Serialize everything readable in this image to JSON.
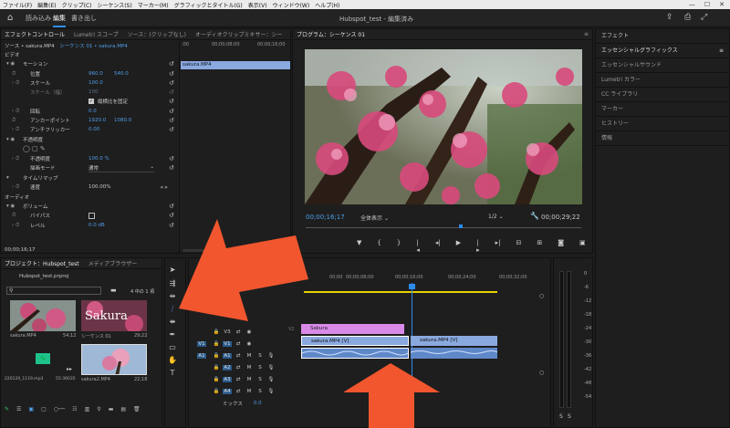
{
  "menu": [
    "ファイル(F)",
    "編集(E)",
    "クリップ(C)",
    "シーケンス(S)",
    "マーカー(M)",
    "グラフィックとタイトル(G)",
    "表示(V)",
    "ウィンドウ(W)",
    "ヘルプ(H)"
  ],
  "workspace_tabs": [
    "読み込み",
    "編集",
    "書き出し"
  ],
  "app_title": "Hubspot_test - 編集済み",
  "left_tabs": [
    "エフェクトコントロール",
    "Lumetri スコープ",
    "ソース：(クリップなし)",
    "オーディオクリップミキサー：シー"
  ],
  "source_bar": {
    "source": "ソース • sakura.MP4",
    "sequence": "シーケンス 01 • sakura.MP4"
  },
  "mini_timeline": {
    "times": [
      ":00",
      "00;00;08;00",
      "00;00;16;00"
    ],
    "clip": "sakura.MP4"
  },
  "effect_controls": {
    "video_section": "ビデオ",
    "motion": "モーション",
    "position": {
      "label": "位置",
      "x": "960.0",
      "y": "540.0"
    },
    "scale": {
      "label": "スケール",
      "value": "100.0"
    },
    "scale_width": {
      "label": "スケール（幅）",
      "value": "100"
    },
    "uniform": "縦横比を固定",
    "rotation": {
      "label": "回転",
      "value": "0.0"
    },
    "anchor": {
      "label": "アンカーポイント",
      "x": "1920.0",
      "y": "1080.0"
    },
    "antiflicker": {
      "label": "アンチフリッカー",
      "value": "0.00"
    },
    "opacity_section": "不透明度",
    "opacity": {
      "label": "不透明度",
      "value": "100.0 %"
    },
    "blend": {
      "label": "描画モード",
      "value": "通常"
    },
    "time_remap": "タイムリマップ",
    "speed": {
      "label": "速度",
      "value": "100.00%"
    },
    "audio_section": "オーディオ",
    "volume": "ボリューム",
    "bypass": "バイパス",
    "level": {
      "label": "レベル",
      "value": "0.0 dB"
    },
    "current_time": "00;00;16;17"
  },
  "program": {
    "tab": "プログラム：シーケンス 01",
    "timecode": "00;00;16;17",
    "fit": "全体表示",
    "resolution": "1/2",
    "duration": "00;00;29;22"
  },
  "right_panel": {
    "items": [
      "エフェクト",
      "エッセンシャルグラフィックス",
      "エッセンシャルサウンド",
      "Lumetri カラー",
      "CC ライブラリ",
      "マーカー",
      "ヒストリー",
      "情報"
    ]
  },
  "project": {
    "tabs": [
      "プロジェクト：Hubspot_test",
      "メディアブラウザー"
    ],
    "file": "Hubspot_test.prproj",
    "count": "4 中の 1 項",
    "items": [
      {
        "name": "sakura.MP4",
        "duration": "54;12"
      },
      {
        "name": "シーケンス 01",
        "duration": "29;22"
      },
      {
        "name": "220120_1119.mp3",
        "duration": "55:36035"
      },
      {
        "name": "sakura2.MP4",
        "duration": "22;18"
      }
    ],
    "thumb_title": "Sakura"
  },
  "timeline": {
    "times": [
      "00;00",
      "00;00;08;00",
      "00;00;16;00",
      "00;00;24;00",
      "00;00;32;00"
    ],
    "tracks": [
      "V3",
      "V2",
      "V1",
      "A1",
      "A2",
      "A3",
      "A4"
    ],
    "mix": {
      "label": "ミックス",
      "value": "0.0"
    },
    "title_clip": "Sakura",
    "clip1": "sakura.MP4 [V]",
    "clip2": "sakura.MP4 [V]"
  },
  "meter": {
    "labels": [
      "0",
      "-6",
      "-12",
      "-18",
      "-24",
      "-30",
      "-36",
      "-42",
      "-48",
      "-54"
    ],
    "s_labels": [
      "S",
      "S"
    ]
  },
  "colors": {
    "accent": "#2d8ceb",
    "arrow": "#f1562e",
    "title_clip": "#d98ae8",
    "video_clip": "#8aa9df"
  }
}
